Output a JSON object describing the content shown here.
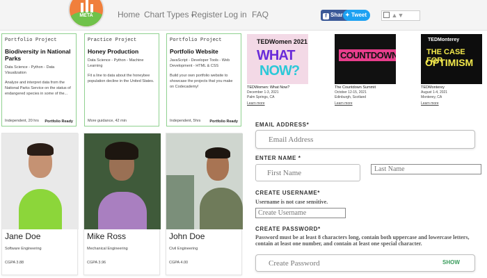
{
  "nav": {
    "logo_text": "META",
    "links": [
      "Home",
      "Chart Types",
      "Register",
      "Log in",
      "FAQ"
    ],
    "dropdown_caret": "▾",
    "share_label": "Share",
    "tweet_label": "Tweet"
  },
  "projects": [
    {
      "kicker": "Portfolio Project",
      "title": "Biodiversity in National Parks",
      "tags": "Data Science - Python - Data Visualization",
      "description": "Analyze and interpret data from the National Parks Service on the status of endangered species in some of the...",
      "footer": "Independent, 20 hrs",
      "badge": "Portfolio Ready"
    },
    {
      "kicker": "Practice Project",
      "title": "Honey Production",
      "tags": "Data Science - Python - Machine Learning",
      "description": "Fit a line to data about the honeybee population decline in the United States.",
      "footer": "More guidance, 42 min",
      "badge": ""
    },
    {
      "kicker": "Portfolio Project",
      "title": "Portfolio Website",
      "tags": "JavaScript - Developer Tools - Web Development - HTML & CSS",
      "description": "Build your own portfolio website to showcase the projects that you make on Codecademy!",
      "footer": "Independent, 5hrs",
      "badge": "Portfolio Ready"
    }
  ],
  "ted_events": [
    {
      "brand": "TEDWomen 2021",
      "art_text_1": "WHAT",
      "art_text_2": "NOW?",
      "title": "TEDWomen: What Now?",
      "dates": "December 1-3, 2021",
      "place": "Palm Springs, CA",
      "more": "Learn more",
      "bg": "#f3d9e6"
    },
    {
      "brand": "",
      "art_text_1": "COUNTDOWN",
      "art_text_2": "",
      "title": "The Countdown Summit",
      "dates": "October 12-15, 2021",
      "place": "Edinburgh, Scotland",
      "more": "Learn more",
      "bg": "#111111"
    },
    {
      "brand": "TEDMonterey",
      "art_text_1": "THE CASE FOR",
      "art_text_2": "OPTIMISM",
      "title": "TEDMonterey",
      "dates": "August 1-4, 2021",
      "place": "Monterey, CA",
      "more": "Learn more",
      "bg": "#0d0d0d"
    }
  ],
  "people": [
    {
      "name": "Jane Doe",
      "role": "Software Engineering",
      "gpa": "CGPA 3.88"
    },
    {
      "name": "Mike Ross",
      "role": "Mechanical Engineering",
      "gpa": "CGPA 3.96"
    },
    {
      "name": "John Doe",
      "role": "Civil Engineering",
      "gpa": "CGPA 4.00"
    }
  ],
  "form": {
    "email_label": "EMAIL ADDRESS*",
    "email_placeholder": "Email Address",
    "name_label": "ENTER NAME *",
    "first_placeholder": "First Name",
    "last_placeholder": "Last Name",
    "username_label": "CREATE USERNAME*",
    "username_hint": "Username is not case sensitive.",
    "username_placeholder": "Create Username",
    "password_label": "CREATE PASSWORD*",
    "password_hint": "Password must be at least 8 characters long, contain both uppercase and lowercase letters, contain at least one number, and contain at least one special character.",
    "password_placeholder": "Create Password",
    "show_label": "SHOW"
  },
  "colors": {
    "facebook": "#3b5998",
    "twitter": "#1da1f2",
    "card_border": "#8fd18f",
    "show": "#3a9d5d"
  }
}
